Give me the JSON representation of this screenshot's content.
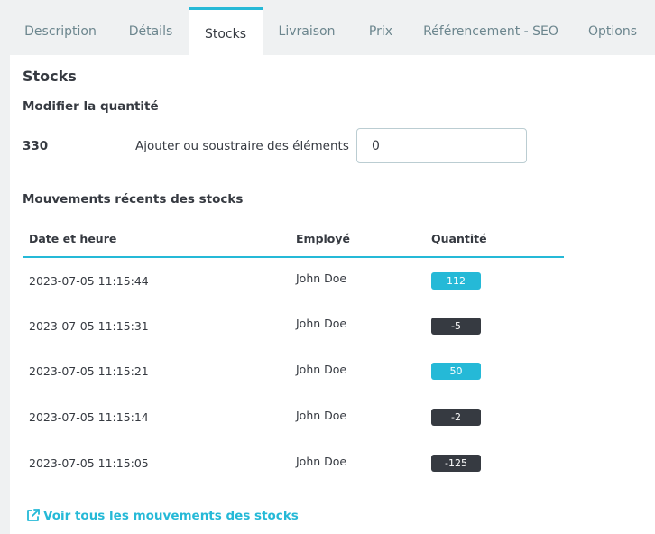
{
  "tabs": [
    {
      "label": "Description",
      "active": false
    },
    {
      "label": "Détails",
      "active": false
    },
    {
      "label": "Stocks",
      "active": true
    },
    {
      "label": "Livraison",
      "active": false
    },
    {
      "label": "Prix",
      "active": false
    },
    {
      "label": "Référencement - SEO",
      "active": false
    },
    {
      "label": "Options",
      "active": false
    }
  ],
  "section": {
    "title": "Stocks",
    "modify_heading": "Modifier la quantité",
    "current_quantity": "330",
    "adjust_label": "Ajouter ou soustraire des éléments",
    "adjust_value": "0",
    "movements_heading": "Mouvements récents des stocks"
  },
  "table": {
    "columns": [
      "Date et heure",
      "Employé",
      "Quantité"
    ],
    "rows": [
      {
        "date": "2023-07-05 11:15:44",
        "employee": "John Doe",
        "quantity": "112",
        "sign": "positive"
      },
      {
        "date": "2023-07-05 11:15:31",
        "employee": "John Doe",
        "quantity": "-5",
        "sign": "negative"
      },
      {
        "date": "2023-07-05 11:15:21",
        "employee": "John Doe",
        "quantity": "50",
        "sign": "positive"
      },
      {
        "date": "2023-07-05 11:15:14",
        "employee": "John Doe",
        "quantity": "-2",
        "sign": "negative"
      },
      {
        "date": "2023-07-05 11:15:05",
        "employee": "John Doe",
        "quantity": "-125",
        "sign": "negative"
      }
    ]
  },
  "link": {
    "label": "Voir tous les mouvements des stocks",
    "icon": "external-link-icon"
  },
  "colors": {
    "accent": "#25b9d7",
    "dark_badge": "#363a41",
    "text": "#363a41",
    "muted_tab": "#6c868e",
    "page_bg": "#eff1f2"
  }
}
